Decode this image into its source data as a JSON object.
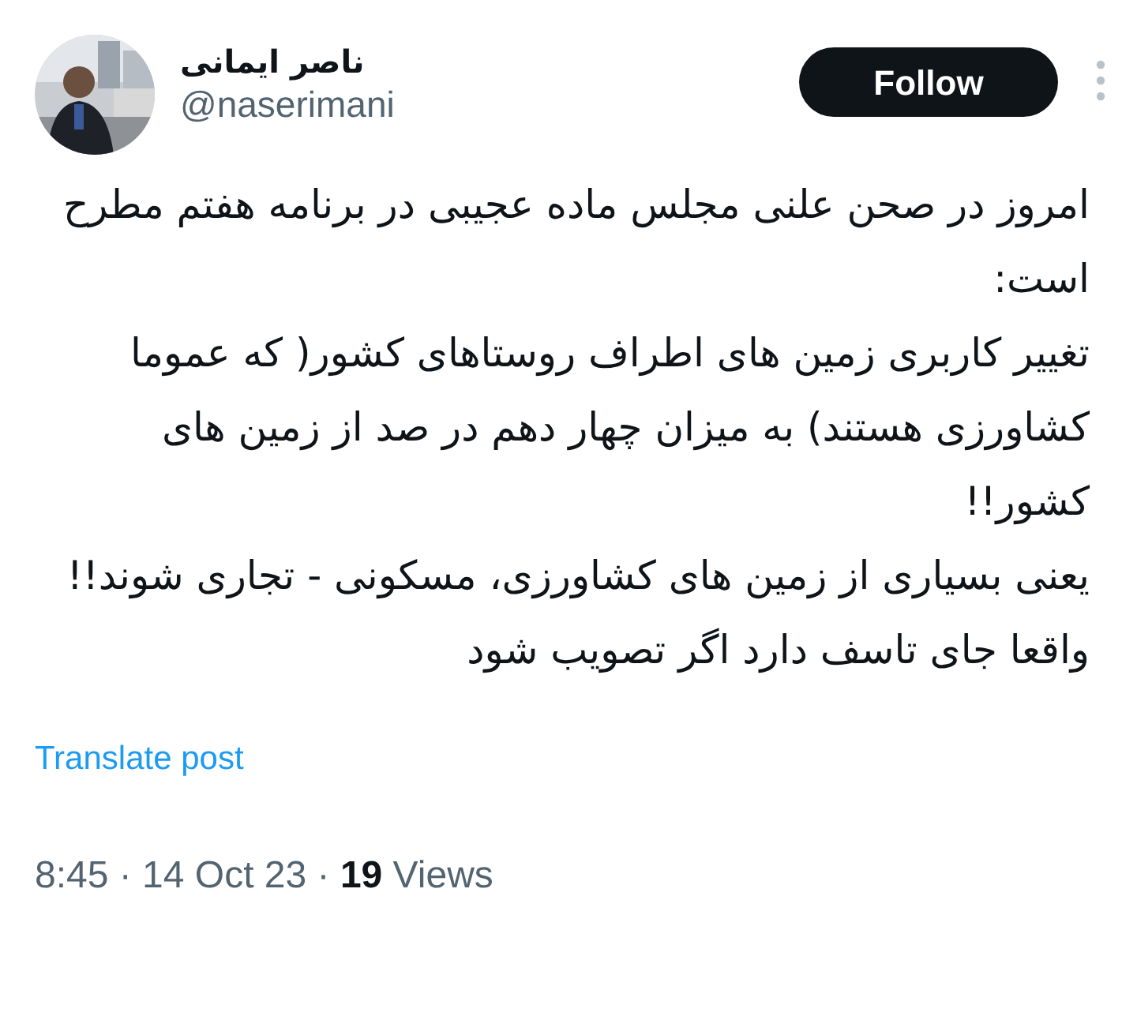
{
  "author": {
    "name": "ناصر ایمانی",
    "handle": "@naserimani"
  },
  "follow_button": "Follow",
  "post": {
    "paragraphs": [
      "امروز در صحن علنی مجلس ماده عجیبی در برنامه هفتم مطرح است:",
      "تغییر کاربری زمین های اطراف روستاهای کشور( که عموما کشاورزی هستند) به میزان چهار دهم در صد از زمین های کشور!!",
      "یعنی بسیاری از زمین های کشاورزی، مسکونی - تجاری شوند!!",
      "واقعا جای تاسف دارد اگر تصویب شود"
    ]
  },
  "translate_link": "Translate post",
  "meta": "8:45 · 14 Oct 23 · **19** Views"
}
